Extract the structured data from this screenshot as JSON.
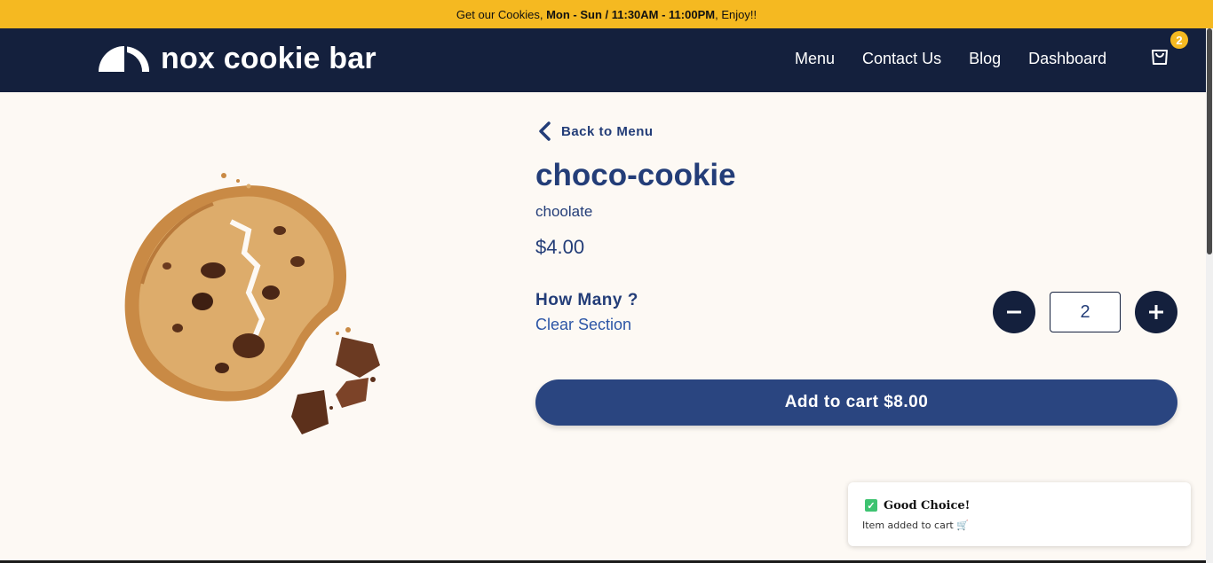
{
  "announcement": {
    "prefix": "Get our Cookies, ",
    "hours": "Mon - Sun / 11:30AM - 11:00PM",
    "suffix": ", Enjoy!!"
  },
  "header": {
    "logo_text": "nox cookie bar",
    "nav": [
      {
        "label": "Menu"
      },
      {
        "label": "Contact Us"
      },
      {
        "label": "Blog"
      },
      {
        "label": "Dashboard"
      }
    ],
    "cart_count": "2",
    "cart_icon": "shopping-bag-icon"
  },
  "product": {
    "back_label": "Back to Menu",
    "name": "choco-cookie",
    "flavor": "choolate",
    "price": "$4.00",
    "quantity_label": "How Many ?",
    "clear_label": "Clear Section",
    "quantity": "2",
    "add_to_cart_label": "Add to cart $8.00"
  },
  "toast": {
    "title": "Good Choice!",
    "message": "Item added to cart 🛒"
  },
  "colors": {
    "accent": "#f5b921",
    "navy": "#14203d",
    "primary": "#2a4580",
    "text": "#233d78"
  }
}
